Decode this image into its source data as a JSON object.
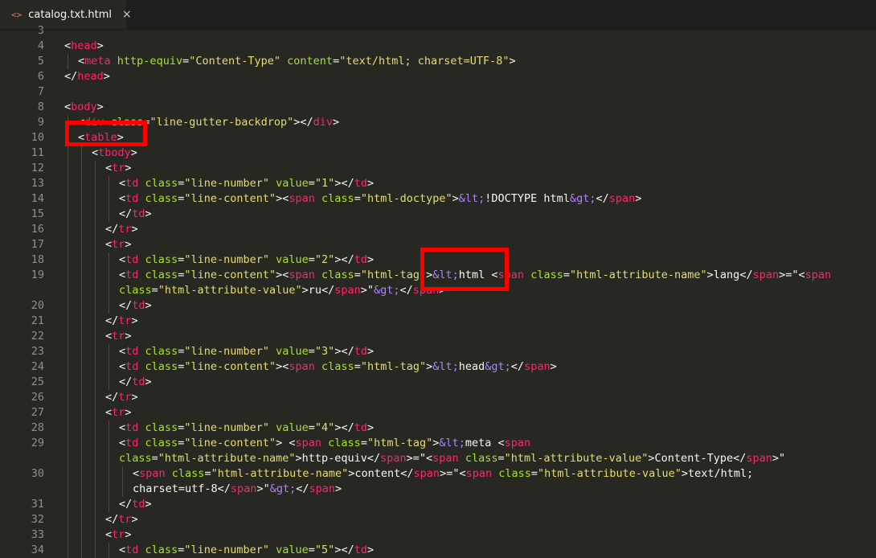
{
  "tab": {
    "icon": "<>",
    "title": "catalog.txt.html",
    "close": "×"
  },
  "lines": [
    {
      "n": "3",
      "indent": 0,
      "tokens": []
    },
    {
      "n": "4",
      "indent": 0,
      "tokens": [
        [
          "p",
          "<"
        ],
        [
          "t",
          "head"
        ],
        [
          "p",
          ">"
        ]
      ]
    },
    {
      "n": "5",
      "indent": 1,
      "tokens": [
        [
          "p",
          "<"
        ],
        [
          "t",
          "meta"
        ],
        [
          "p",
          " "
        ],
        [
          "a",
          "http-equiv"
        ],
        [
          "p",
          "="
        ],
        [
          "s",
          "\"Content-Type\""
        ],
        [
          "p",
          " "
        ],
        [
          "a",
          "content"
        ],
        [
          "p",
          "="
        ],
        [
          "s",
          "\"text/html; charset=UTF-8\""
        ],
        [
          "p",
          ">"
        ]
      ]
    },
    {
      "n": "6",
      "indent": 0,
      "tokens": [
        [
          "p",
          "</"
        ],
        [
          "t",
          "head"
        ],
        [
          "p",
          ">"
        ]
      ]
    },
    {
      "n": "7",
      "indent": 0,
      "tokens": []
    },
    {
      "n": "8",
      "indent": 0,
      "tokens": [
        [
          "p",
          "<"
        ],
        [
          "t",
          "body"
        ],
        [
          "p",
          ">"
        ]
      ]
    },
    {
      "n": "9",
      "indent": 1,
      "tokens": [
        [
          "p",
          "<"
        ],
        [
          "t",
          "div"
        ],
        [
          "p",
          " "
        ],
        [
          "a",
          "class"
        ],
        [
          "p",
          "="
        ],
        [
          "s",
          "\"line-gutter-backdrop\""
        ],
        [
          "p",
          "></"
        ],
        [
          "t",
          "div"
        ],
        [
          "p",
          ">"
        ]
      ]
    },
    {
      "n": "10",
      "indent": 1,
      "tokens": [
        [
          "p",
          "<"
        ],
        [
          "t",
          "table"
        ],
        [
          "p",
          ">"
        ]
      ]
    },
    {
      "n": "11",
      "indent": 2,
      "tokens": [
        [
          "p",
          "<"
        ],
        [
          "t",
          "tbody"
        ],
        [
          "p",
          ">"
        ]
      ]
    },
    {
      "n": "12",
      "indent": 3,
      "tokens": [
        [
          "p",
          "<"
        ],
        [
          "t",
          "tr"
        ],
        [
          "p",
          ">"
        ]
      ]
    },
    {
      "n": "13",
      "indent": 4,
      "tokens": [
        [
          "p",
          "<"
        ],
        [
          "t",
          "td"
        ],
        [
          "p",
          " "
        ],
        [
          "a",
          "class"
        ],
        [
          "p",
          "="
        ],
        [
          "s",
          "\"line-number\""
        ],
        [
          "p",
          " "
        ],
        [
          "a",
          "value"
        ],
        [
          "p",
          "="
        ],
        [
          "s",
          "\"1\""
        ],
        [
          "p",
          "></"
        ],
        [
          "t",
          "td"
        ],
        [
          "p",
          ">"
        ]
      ]
    },
    {
      "n": "14",
      "indent": 4,
      "tokens": [
        [
          "p",
          "<"
        ],
        [
          "t",
          "td"
        ],
        [
          "p",
          " "
        ],
        [
          "a",
          "class"
        ],
        [
          "p",
          "="
        ],
        [
          "s",
          "\"line-content\""
        ],
        [
          "p",
          "><"
        ],
        [
          "t",
          "span"
        ],
        [
          "p",
          " "
        ],
        [
          "a",
          "class"
        ],
        [
          "p",
          "="
        ],
        [
          "s",
          "\"html-doctype\""
        ],
        [
          "p",
          ">"
        ],
        [
          "e",
          "&lt;"
        ],
        [
          "p",
          "!DOCTYPE html"
        ],
        [
          "e",
          "&gt;"
        ],
        [
          "p",
          "</"
        ],
        [
          "t",
          "span"
        ],
        [
          "p",
          ">"
        ]
      ]
    },
    {
      "n": "15",
      "indent": 4,
      "tokens": [
        [
          "p",
          "</"
        ],
        [
          "t",
          "td"
        ],
        [
          "p",
          ">"
        ]
      ]
    },
    {
      "n": "16",
      "indent": 3,
      "tokens": [
        [
          "p",
          "</"
        ],
        [
          "t",
          "tr"
        ],
        [
          "p",
          ">"
        ]
      ]
    },
    {
      "n": "17",
      "indent": 3,
      "tokens": [
        [
          "p",
          "<"
        ],
        [
          "t",
          "tr"
        ],
        [
          "p",
          ">"
        ]
      ]
    },
    {
      "n": "18",
      "indent": 4,
      "tokens": [
        [
          "p",
          "<"
        ],
        [
          "t",
          "td"
        ],
        [
          "p",
          " "
        ],
        [
          "a",
          "class"
        ],
        [
          "p",
          "="
        ],
        [
          "s",
          "\"line-number\""
        ],
        [
          "p",
          " "
        ],
        [
          "a",
          "value"
        ],
        [
          "p",
          "="
        ],
        [
          "s",
          "\"2\""
        ],
        [
          "p",
          "></"
        ],
        [
          "t",
          "td"
        ],
        [
          "p",
          ">"
        ]
      ]
    },
    {
      "n": "19",
      "indent": 4,
      "tokens": [
        [
          "p",
          "<"
        ],
        [
          "t",
          "td"
        ],
        [
          "p",
          " "
        ],
        [
          "a",
          "class"
        ],
        [
          "p",
          "="
        ],
        [
          "s",
          "\"line-content\""
        ],
        [
          "p",
          "><"
        ],
        [
          "t",
          "span"
        ],
        [
          "p",
          " "
        ],
        [
          "a",
          "class"
        ],
        [
          "p",
          "="
        ],
        [
          "s",
          "\"html-tag\""
        ],
        [
          "p",
          ">"
        ],
        [
          "e",
          "&lt;"
        ],
        [
          "p",
          "html <"
        ],
        [
          "t",
          "span"
        ],
        [
          "p",
          " "
        ],
        [
          "a",
          "class"
        ],
        [
          "p",
          "="
        ],
        [
          "s",
          "\"html-attribute-name\""
        ],
        [
          "p",
          ">lang</"
        ],
        [
          "t",
          "span"
        ],
        [
          "p",
          ">=\"<"
        ],
        [
          "t",
          "span"
        ]
      ]
    },
    {
      "n": "",
      "indent": 4,
      "tokens": [
        [
          "a",
          "class"
        ],
        [
          "p",
          "="
        ],
        [
          "s",
          "\"html-attribute-value\""
        ],
        [
          "p",
          ">ru</"
        ],
        [
          "t",
          "span"
        ],
        [
          "p",
          ">\""
        ],
        [
          "e",
          "&gt;"
        ],
        [
          "p",
          "</"
        ],
        [
          "t",
          "span"
        ],
        [
          "p",
          ">"
        ]
      ]
    },
    {
      "n": "20",
      "indent": 4,
      "tokens": [
        [
          "p",
          "</"
        ],
        [
          "t",
          "td"
        ],
        [
          "p",
          ">"
        ]
      ]
    },
    {
      "n": "21",
      "indent": 3,
      "tokens": [
        [
          "p",
          "</"
        ],
        [
          "t",
          "tr"
        ],
        [
          "p",
          ">"
        ]
      ]
    },
    {
      "n": "22",
      "indent": 3,
      "tokens": [
        [
          "p",
          "<"
        ],
        [
          "t",
          "tr"
        ],
        [
          "p",
          ">"
        ]
      ]
    },
    {
      "n": "23",
      "indent": 4,
      "tokens": [
        [
          "p",
          "<"
        ],
        [
          "t",
          "td"
        ],
        [
          "p",
          " "
        ],
        [
          "a",
          "class"
        ],
        [
          "p",
          "="
        ],
        [
          "s",
          "\"line-number\""
        ],
        [
          "p",
          " "
        ],
        [
          "a",
          "value"
        ],
        [
          "p",
          "="
        ],
        [
          "s",
          "\"3\""
        ],
        [
          "p",
          "></"
        ],
        [
          "t",
          "td"
        ],
        [
          "p",
          ">"
        ]
      ]
    },
    {
      "n": "24",
      "indent": 4,
      "tokens": [
        [
          "p",
          "<"
        ],
        [
          "t",
          "td"
        ],
        [
          "p",
          " "
        ],
        [
          "a",
          "class"
        ],
        [
          "p",
          "="
        ],
        [
          "s",
          "\"line-content\""
        ],
        [
          "p",
          "><"
        ],
        [
          "t",
          "span"
        ],
        [
          "p",
          " "
        ],
        [
          "a",
          "class"
        ],
        [
          "p",
          "="
        ],
        [
          "s",
          "\"html-tag\""
        ],
        [
          "p",
          ">"
        ],
        [
          "e",
          "&lt;"
        ],
        [
          "p",
          "head"
        ],
        [
          "e",
          "&gt;"
        ],
        [
          "p",
          "</"
        ],
        [
          "t",
          "span"
        ],
        [
          "p",
          ">"
        ]
      ]
    },
    {
      "n": "25",
      "indent": 4,
      "tokens": [
        [
          "p",
          "</"
        ],
        [
          "t",
          "td"
        ],
        [
          "p",
          ">"
        ]
      ]
    },
    {
      "n": "26",
      "indent": 3,
      "tokens": [
        [
          "p",
          "</"
        ],
        [
          "t",
          "tr"
        ],
        [
          "p",
          ">"
        ]
      ]
    },
    {
      "n": "27",
      "indent": 3,
      "tokens": [
        [
          "p",
          "<"
        ],
        [
          "t",
          "tr"
        ],
        [
          "p",
          ">"
        ]
      ]
    },
    {
      "n": "28",
      "indent": 4,
      "tokens": [
        [
          "p",
          "<"
        ],
        [
          "t",
          "td"
        ],
        [
          "p",
          " "
        ],
        [
          "a",
          "class"
        ],
        [
          "p",
          "="
        ],
        [
          "s",
          "\"line-number\""
        ],
        [
          "p",
          " "
        ],
        [
          "a",
          "value"
        ],
        [
          "p",
          "="
        ],
        [
          "s",
          "\"4\""
        ],
        [
          "p",
          "></"
        ],
        [
          "t",
          "td"
        ],
        [
          "p",
          ">"
        ]
      ]
    },
    {
      "n": "29",
      "indent": 4,
      "tokens": [
        [
          "p",
          "<"
        ],
        [
          "t",
          "td"
        ],
        [
          "p",
          " "
        ],
        [
          "a",
          "class"
        ],
        [
          "p",
          "="
        ],
        [
          "s",
          "\"line-content\""
        ],
        [
          "p",
          "> <"
        ],
        [
          "t",
          "span"
        ],
        [
          "p",
          " "
        ],
        [
          "a",
          "class"
        ],
        [
          "p",
          "="
        ],
        [
          "s",
          "\"html-tag\""
        ],
        [
          "p",
          ">"
        ],
        [
          "e",
          "&lt;"
        ],
        [
          "p",
          "meta <"
        ],
        [
          "t",
          "span"
        ]
      ]
    },
    {
      "n": "",
      "indent": 4,
      "tokens": [
        [
          "a",
          "class"
        ],
        [
          "p",
          "="
        ],
        [
          "s",
          "\"html-attribute-name\""
        ],
        [
          "p",
          ">http-equiv</"
        ],
        [
          "t",
          "span"
        ],
        [
          "p",
          ">=\"<"
        ],
        [
          "t",
          "span"
        ],
        [
          "p",
          " "
        ],
        [
          "a",
          "class"
        ],
        [
          "p",
          "="
        ],
        [
          "s",
          "\"html-attribute-value\""
        ],
        [
          "p",
          ">Content-Type</"
        ],
        [
          "t",
          "span"
        ],
        [
          "p",
          ">\""
        ]
      ]
    },
    {
      "n": "30",
      "indent": 5,
      "tokens": [
        [
          "p",
          "<"
        ],
        [
          "t",
          "span"
        ],
        [
          "p",
          " "
        ],
        [
          "a",
          "class"
        ],
        [
          "p",
          "="
        ],
        [
          "s",
          "\"html-attribute-name\""
        ],
        [
          "p",
          ">content</"
        ],
        [
          "t",
          "span"
        ],
        [
          "p",
          ">=\"<"
        ],
        [
          "t",
          "span"
        ],
        [
          "p",
          " "
        ],
        [
          "a",
          "class"
        ],
        [
          "p",
          "="
        ],
        [
          "s",
          "\"html-attribute-value\""
        ],
        [
          "p",
          ">text/html;"
        ]
      ]
    },
    {
      "n": "",
      "indent": 5,
      "tokens": [
        [
          "p",
          "charset=utf-8</"
        ],
        [
          "t",
          "span"
        ],
        [
          "p",
          ">\""
        ],
        [
          "e",
          "&gt;"
        ],
        [
          "p",
          "</"
        ],
        [
          "t",
          "span"
        ],
        [
          "p",
          ">"
        ]
      ]
    },
    {
      "n": "31",
      "indent": 4,
      "tokens": [
        [
          "p",
          "</"
        ],
        [
          "t",
          "td"
        ],
        [
          "p",
          ">"
        ]
      ]
    },
    {
      "n": "32",
      "indent": 3,
      "tokens": [
        [
          "p",
          "</"
        ],
        [
          "t",
          "tr"
        ],
        [
          "p",
          ">"
        ]
      ]
    },
    {
      "n": "33",
      "indent": 3,
      "tokens": [
        [
          "p",
          "<"
        ],
        [
          "t",
          "tr"
        ],
        [
          "p",
          ">"
        ]
      ]
    },
    {
      "n": "34",
      "indent": 4,
      "tokens": [
        [
          "p",
          "<"
        ],
        [
          "t",
          "td"
        ],
        [
          "p",
          " "
        ],
        [
          "a",
          "class"
        ],
        [
          "p",
          "="
        ],
        [
          "s",
          "\"line-number\""
        ],
        [
          "p",
          " "
        ],
        [
          "a",
          "value"
        ],
        [
          "p",
          "="
        ],
        [
          "s",
          "\"5\""
        ],
        [
          "p",
          "></"
        ],
        [
          "t",
          "td"
        ],
        [
          "p",
          ">"
        ]
      ]
    }
  ]
}
